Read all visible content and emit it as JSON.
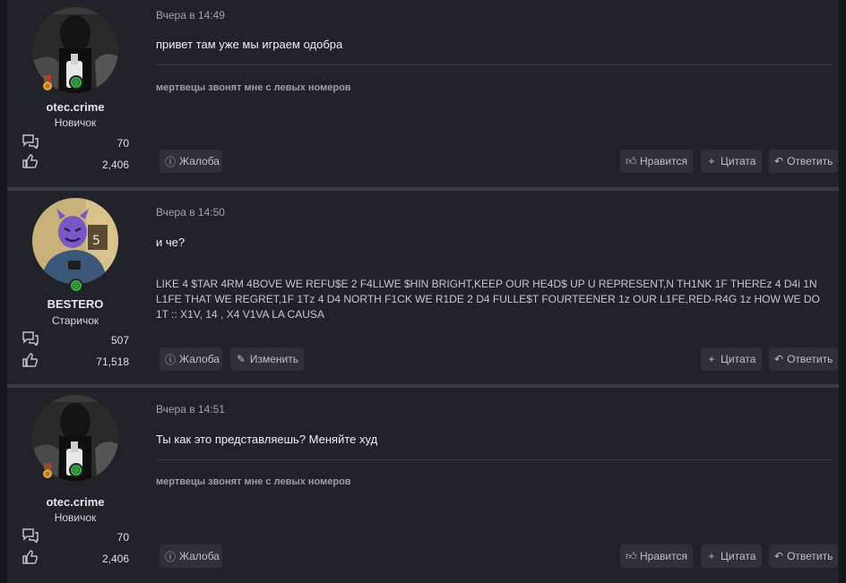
{
  "posts": [
    {
      "username": "otec.crime",
      "rank": "Новичок",
      "messages_count": "70",
      "likes_count": "2,406",
      "time": "Вчера в 14:49",
      "message": "привет там уже мы играем одобра",
      "signature": "мертвецы звонят мне с левых номеров",
      "buttons": {
        "report": "Жалоба",
        "like": "Нравится",
        "quote": "Цитата",
        "reply": "Ответить"
      }
    },
    {
      "username": "BESTERO",
      "rank": "Старичок",
      "messages_count": "507",
      "likes_count": "71,518",
      "time": "Вчера в 14:50",
      "message": "и че?",
      "long_text": "LIKE 4 $TAR 4RM 4BOVE WE REFU$E 2 F4LLWE $HIN BRIGHT,KEEP OUR HE4D$ UP U REPRESENT,N TH1NK 1F THEREz 4 D4i 1N L1FE THAT WE REGRET,1F 1Tz 4 D4 NORTH F1CK WE R1DE 2 D4 FULLE$T FOURTEENER 1z OUR L1FE,RED-R4G 1z HOW WE DO 1T :: X1V, 14 , X4 V1VA LA CAUSA",
      "buttons": {
        "report": "Жалоба",
        "edit": "Изменить",
        "quote": "Цитата",
        "reply": "Ответить"
      }
    },
    {
      "username": "otec.crime",
      "rank": "Новичок",
      "messages_count": "70",
      "likes_count": "2,406",
      "time": "Вчера в 14:51",
      "message": "Ты как это представляешь? Меняйте худ",
      "signature": "мертвецы звонят мне с левых номеров",
      "buttons": {
        "report": "Жалоба",
        "like": "Нравится",
        "quote": "Цитата",
        "reply": "Ответить"
      }
    }
  ],
  "colors": {
    "background": "#17181c",
    "post_bg": "#22232a",
    "button_bg": "#2f3038",
    "online": "#3cb043"
  },
  "icons": {
    "messages": "speech-bubbles-icon",
    "likes": "thumbs-up-icon",
    "report": "alert-circle-icon",
    "like": "thumbs-up-icon",
    "edit": "pencil-icon",
    "quote": "plus-icon",
    "reply": "reply-arrow-icon"
  }
}
